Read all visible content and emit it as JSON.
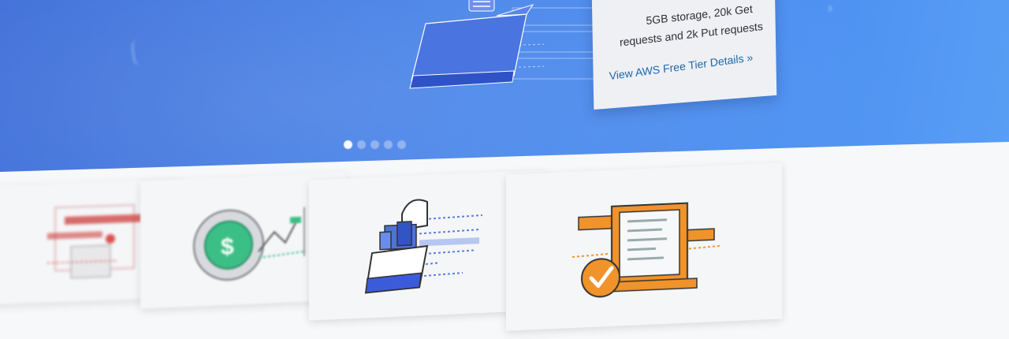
{
  "hero": {
    "info_card": {
      "line_1": "5GB storage, 20k Get",
      "line_2": "requests and 2k Put requests",
      "link_label": "View AWS Free Tier Details »"
    },
    "carousel": {
      "total_slides": 5,
      "active_slide": 1
    }
  },
  "colors": {
    "hero_blue": "#4a86ea",
    "link_blue": "#1f66a8",
    "accent_orange": "#f0932b",
    "accent_red": "#d9534f",
    "accent_green": "#2fb37f",
    "illustration_blue": "#3b5bdb"
  },
  "tiles": [
    {
      "icon": "web-forms-icon"
    },
    {
      "icon": "dollar-growth-chart-icon"
    },
    {
      "icon": "storage-bucket-icon"
    },
    {
      "icon": "approved-document-icon"
    }
  ]
}
